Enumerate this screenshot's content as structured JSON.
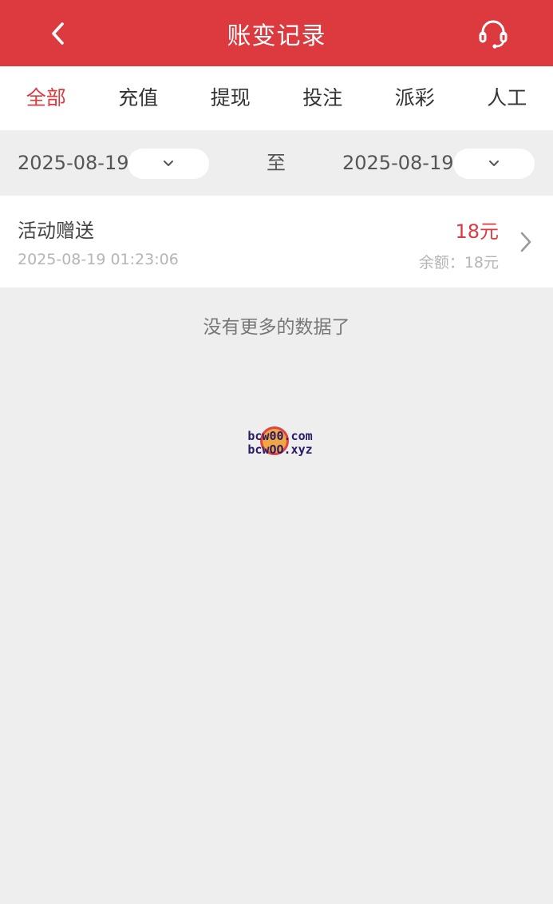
{
  "header": {
    "title": "账变记录",
    "back_icon": "chevron-left-icon",
    "support_icon": "headset-icon"
  },
  "tabs": [
    {
      "label": "全部",
      "active": true
    },
    {
      "label": "充值",
      "active": false
    },
    {
      "label": "提现",
      "active": false
    },
    {
      "label": "投注",
      "active": false
    },
    {
      "label": "派彩",
      "active": false
    },
    {
      "label": "人工",
      "active": false
    }
  ],
  "date_filter": {
    "start_date": "2025-08-19",
    "to_label": "至",
    "end_date": "2025-08-19"
  },
  "records": [
    {
      "title": "活动赠送",
      "time": "2025-08-19 01:23:06",
      "amount": "18元",
      "balance": "余额：18元"
    }
  ],
  "footer_text": "没有更多的数据了",
  "watermark": {
    "line1": "bcw00.com",
    "line2": "bcwOO.xyz"
  },
  "colors": {
    "brand": "#dc3a3f",
    "background": "#eeeeee"
  }
}
